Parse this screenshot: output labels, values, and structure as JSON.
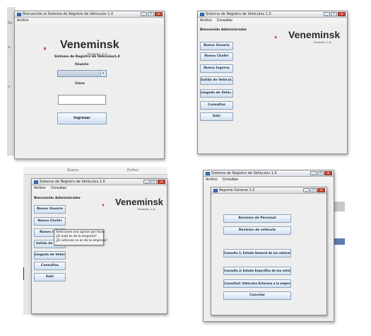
{
  "brand": {
    "name": "Veneminsk",
    "sub": "Tractores, C.A."
  },
  "login": {
    "title": "Bienvenido al Sistema de Registro de Vehiculos 1.0",
    "menu": [
      "Archivo"
    ],
    "heading": "Sistema de Registro de Vehiculos1.0",
    "user_label": "Usuario",
    "user_value": "",
    "pass_label": "Clave",
    "pass_value": "",
    "login_button": "Ingresar"
  },
  "main": {
    "title": "Sistema de Registro de Vehiculos 1.0",
    "menu": [
      "Archivo",
      "Consultas"
    ],
    "welcome": "Bienvenido Administrador",
    "buttons": [
      "Nuevo Usuario",
      "Nuevo Chofer",
      "Nuevo Ingreso",
      "Salida de Vehicul...",
      "Llegada de Vehic...",
      "Consultas",
      "Salir"
    ]
  },
  "prompt": {
    "title": "Sistema de Registro de Vehiculos 1.0",
    "menu": [
      "Archivo",
      "Consultas"
    ],
    "welcome": "Bienvenido Administrador",
    "buttons": [
      "Nuevo Usuario",
      "Nuevo Chofer",
      "Nuevo Ing",
      "Salida de Ve",
      "Llegada de Vehic...",
      "Consultas",
      "Salir"
    ],
    "tooltip": [
      "Seleccione una opcion por favor",
      "¿El auto es de la empresa?",
      "¿El vehiculo no es de la empresa?"
    ],
    "bg_header": [
      "Nuevo",
      "Estilos"
    ]
  },
  "consultas": {
    "title": "Sistema de Registro de Vehiculos 1.0",
    "menu": [
      "Archivo",
      "Consultas"
    ],
    "inner_title": "Reporte General 1.0",
    "buttons": [
      "Revision de Personal",
      "Revision de vehiculo",
      "Consulta 1: Estado General de los vehiculos",
      "Consulta 2: Estado Especifico de los vehiculos",
      "Consulta3: Vehiculos Externos a la empresa",
      "Cancelar"
    ]
  },
  "colors": {
    "accent_red": "#cc1f2d",
    "brand_text": "#2a2a2a",
    "button_top": "#f9fbfd",
    "button_bottom": "#cfdff0"
  }
}
